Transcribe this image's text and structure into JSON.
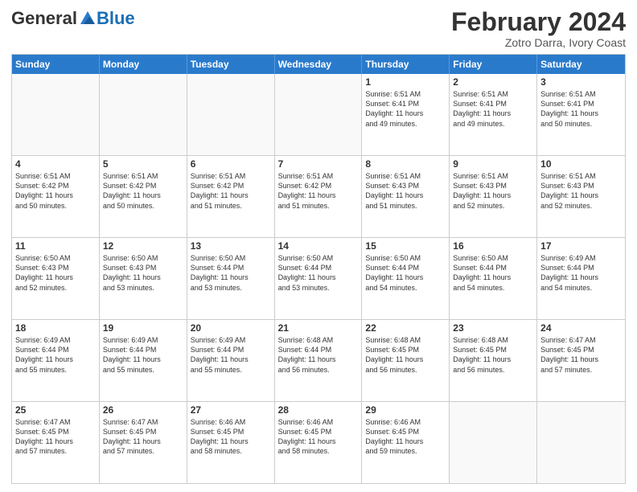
{
  "header": {
    "logo": {
      "general": "General",
      "blue": "Blue"
    },
    "title": "February 2024",
    "location": "Zotro Darra, Ivory Coast"
  },
  "days": [
    "Sunday",
    "Monday",
    "Tuesday",
    "Wednesday",
    "Thursday",
    "Friday",
    "Saturday"
  ],
  "weeks": [
    [
      {
        "day": "",
        "info": ""
      },
      {
        "day": "",
        "info": ""
      },
      {
        "day": "",
        "info": ""
      },
      {
        "day": "",
        "info": ""
      },
      {
        "day": "1",
        "info": "Sunrise: 6:51 AM\nSunset: 6:41 PM\nDaylight: 11 hours\nand 49 minutes."
      },
      {
        "day": "2",
        "info": "Sunrise: 6:51 AM\nSunset: 6:41 PM\nDaylight: 11 hours\nand 49 minutes."
      },
      {
        "day": "3",
        "info": "Sunrise: 6:51 AM\nSunset: 6:41 PM\nDaylight: 11 hours\nand 50 minutes."
      }
    ],
    [
      {
        "day": "4",
        "info": "Sunrise: 6:51 AM\nSunset: 6:42 PM\nDaylight: 11 hours\nand 50 minutes."
      },
      {
        "day": "5",
        "info": "Sunrise: 6:51 AM\nSunset: 6:42 PM\nDaylight: 11 hours\nand 50 minutes."
      },
      {
        "day": "6",
        "info": "Sunrise: 6:51 AM\nSunset: 6:42 PM\nDaylight: 11 hours\nand 51 minutes."
      },
      {
        "day": "7",
        "info": "Sunrise: 6:51 AM\nSunset: 6:42 PM\nDaylight: 11 hours\nand 51 minutes."
      },
      {
        "day": "8",
        "info": "Sunrise: 6:51 AM\nSunset: 6:43 PM\nDaylight: 11 hours\nand 51 minutes."
      },
      {
        "day": "9",
        "info": "Sunrise: 6:51 AM\nSunset: 6:43 PM\nDaylight: 11 hours\nand 52 minutes."
      },
      {
        "day": "10",
        "info": "Sunrise: 6:51 AM\nSunset: 6:43 PM\nDaylight: 11 hours\nand 52 minutes."
      }
    ],
    [
      {
        "day": "11",
        "info": "Sunrise: 6:50 AM\nSunset: 6:43 PM\nDaylight: 11 hours\nand 52 minutes."
      },
      {
        "day": "12",
        "info": "Sunrise: 6:50 AM\nSunset: 6:43 PM\nDaylight: 11 hours\nand 53 minutes."
      },
      {
        "day": "13",
        "info": "Sunrise: 6:50 AM\nSunset: 6:44 PM\nDaylight: 11 hours\nand 53 minutes."
      },
      {
        "day": "14",
        "info": "Sunrise: 6:50 AM\nSunset: 6:44 PM\nDaylight: 11 hours\nand 53 minutes."
      },
      {
        "day": "15",
        "info": "Sunrise: 6:50 AM\nSunset: 6:44 PM\nDaylight: 11 hours\nand 54 minutes."
      },
      {
        "day": "16",
        "info": "Sunrise: 6:50 AM\nSunset: 6:44 PM\nDaylight: 11 hours\nand 54 minutes."
      },
      {
        "day": "17",
        "info": "Sunrise: 6:49 AM\nSunset: 6:44 PM\nDaylight: 11 hours\nand 54 minutes."
      }
    ],
    [
      {
        "day": "18",
        "info": "Sunrise: 6:49 AM\nSunset: 6:44 PM\nDaylight: 11 hours\nand 55 minutes."
      },
      {
        "day": "19",
        "info": "Sunrise: 6:49 AM\nSunset: 6:44 PM\nDaylight: 11 hours\nand 55 minutes."
      },
      {
        "day": "20",
        "info": "Sunrise: 6:49 AM\nSunset: 6:44 PM\nDaylight: 11 hours\nand 55 minutes."
      },
      {
        "day": "21",
        "info": "Sunrise: 6:48 AM\nSunset: 6:44 PM\nDaylight: 11 hours\nand 56 minutes."
      },
      {
        "day": "22",
        "info": "Sunrise: 6:48 AM\nSunset: 6:45 PM\nDaylight: 11 hours\nand 56 minutes."
      },
      {
        "day": "23",
        "info": "Sunrise: 6:48 AM\nSunset: 6:45 PM\nDaylight: 11 hours\nand 56 minutes."
      },
      {
        "day": "24",
        "info": "Sunrise: 6:47 AM\nSunset: 6:45 PM\nDaylight: 11 hours\nand 57 minutes."
      }
    ],
    [
      {
        "day": "25",
        "info": "Sunrise: 6:47 AM\nSunset: 6:45 PM\nDaylight: 11 hours\nand 57 minutes."
      },
      {
        "day": "26",
        "info": "Sunrise: 6:47 AM\nSunset: 6:45 PM\nDaylight: 11 hours\nand 57 minutes."
      },
      {
        "day": "27",
        "info": "Sunrise: 6:46 AM\nSunset: 6:45 PM\nDaylight: 11 hours\nand 58 minutes."
      },
      {
        "day": "28",
        "info": "Sunrise: 6:46 AM\nSunset: 6:45 PM\nDaylight: 11 hours\nand 58 minutes."
      },
      {
        "day": "29",
        "info": "Sunrise: 6:46 AM\nSunset: 6:45 PM\nDaylight: 11 hours\nand 59 minutes."
      },
      {
        "day": "",
        "info": ""
      },
      {
        "day": "",
        "info": ""
      }
    ]
  ]
}
